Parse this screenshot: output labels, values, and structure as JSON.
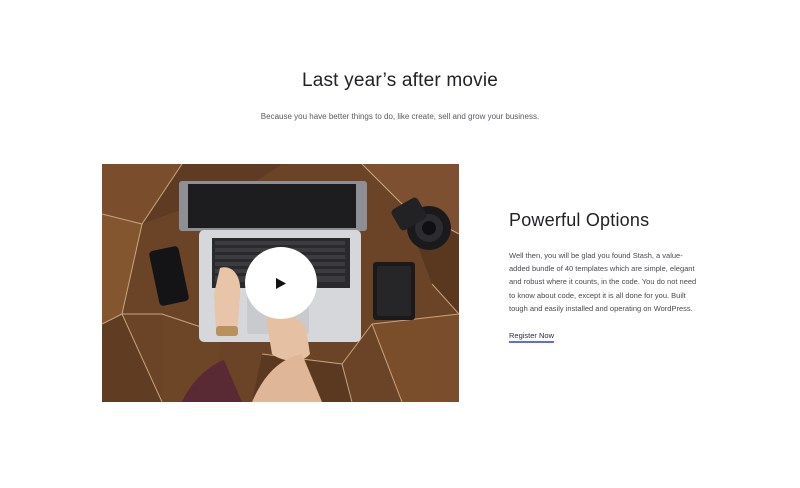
{
  "section": {
    "title": "Last year’s after movie",
    "subtitle": "Because you have better things to do, like create, sell and grow your business."
  },
  "video": {
    "play_icon": "play-icon"
  },
  "feature": {
    "title": "Powerful Options",
    "description": "Well then, you will be glad you found Stash, a value-added bundle of 40 templates which are simple, elegant and robust where it counts, in the code. You do not need to know about code, except it is all done for you. Built tough and easily installed and operating on WordPress.",
    "link_label": "Register Now"
  },
  "colors": {
    "link_underline": "#5b6cf0",
    "text_dark": "#222226",
    "text_body": "#4a4a50"
  }
}
